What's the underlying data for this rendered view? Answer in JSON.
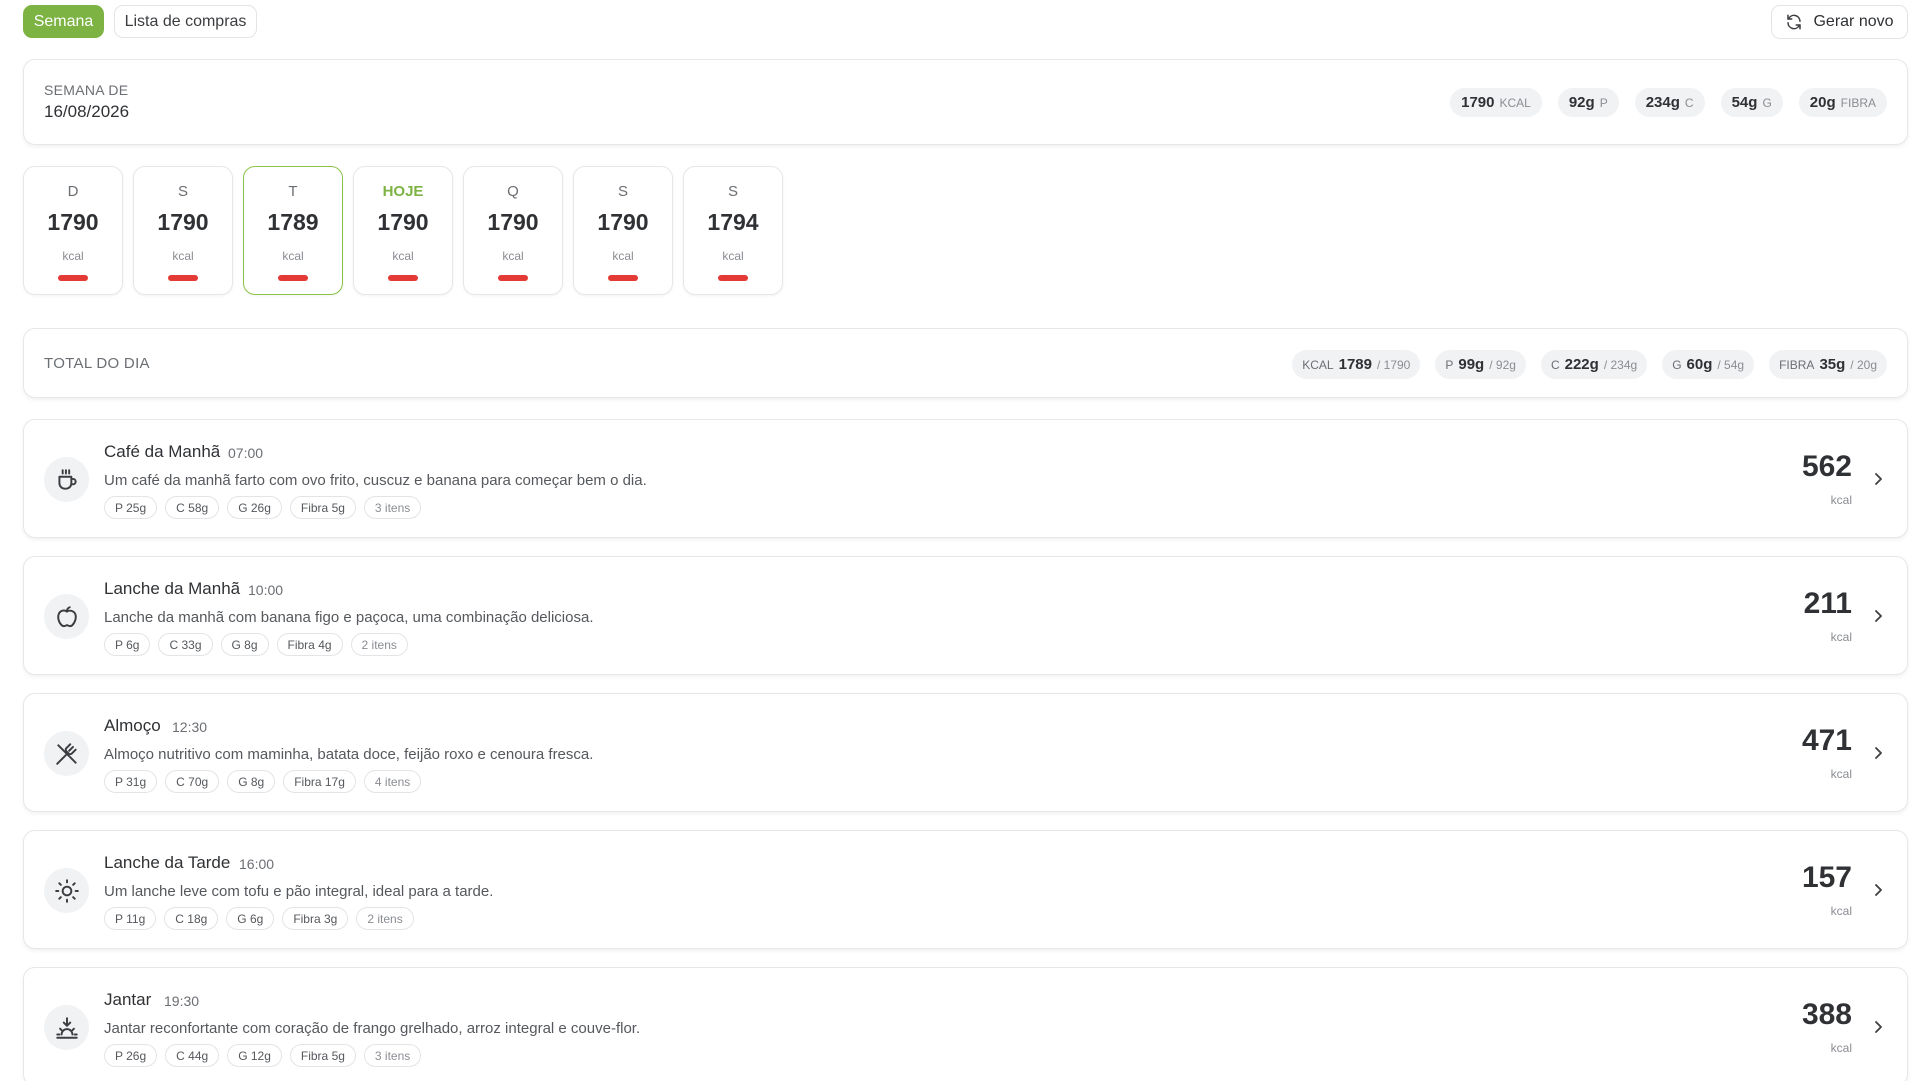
{
  "tabs": {
    "week": "Semana",
    "shopping": "Lista de compras",
    "generate": "Gerar novo"
  },
  "week": {
    "label": "SEMANA DE",
    "date": "16/08/2026",
    "macros": [
      {
        "value": "1790",
        "unit": "KCAL"
      },
      {
        "value": "92g",
        "unit": "P"
      },
      {
        "value": "234g",
        "unit": "C"
      },
      {
        "value": "54g",
        "unit": "G"
      },
      {
        "value": "20g",
        "unit": "FIBRA"
      }
    ]
  },
  "days": [
    {
      "label": "D",
      "kcal": "1790",
      "unit": "kcal"
    },
    {
      "label": "S",
      "kcal": "1790",
      "unit": "kcal"
    },
    {
      "label": "T",
      "kcal": "1789",
      "unit": "kcal",
      "selected": true
    },
    {
      "label": "HOJE",
      "kcal": "1790",
      "unit": "kcal",
      "today": true
    },
    {
      "label": "Q",
      "kcal": "1790",
      "unit": "kcal"
    },
    {
      "label": "S",
      "kcal": "1790",
      "unit": "kcal"
    },
    {
      "label": "S",
      "kcal": "1794",
      "unit": "kcal"
    }
  ],
  "total": {
    "label": "TOTAL DO DIA",
    "items": [
      {
        "key": "KCAL",
        "value": "1789",
        "target": "/ 1790"
      },
      {
        "key": "P",
        "value": "99g",
        "target": "/ 92g"
      },
      {
        "key": "C",
        "value": "222g",
        "target": "/ 234g"
      },
      {
        "key": "G",
        "value": "60g",
        "target": "/ 54g"
      },
      {
        "key": "FIBRA",
        "value": "35g",
        "target": "/ 20g"
      }
    ]
  },
  "meals": [
    {
      "name": "Café da Manhã",
      "time": "07:00",
      "desc": "Um café da manhã farto com ovo frito, cuscuz e banana para começar bem o dia.",
      "chips": [
        "P 25g",
        "C 58g",
        "G 26g",
        "Fibra 5g"
      ],
      "items": "3 itens",
      "kcal": "562",
      "unit": "kcal",
      "icon": "coffee-icon"
    },
    {
      "name": "Lanche da Manhã",
      "time": "10:00",
      "desc": "Lanche da manhã com banana figo e paçoca, uma combinação deliciosa.",
      "chips": [
        "P 6g",
        "C 33g",
        "G 8g",
        "Fibra 4g"
      ],
      "items": "2 itens",
      "kcal": "211",
      "unit": "kcal",
      "icon": "apple-icon"
    },
    {
      "name": "Almoço",
      "time": "12:30",
      "desc": "Almoço nutritivo com maminha, batata doce, feijão roxo e cenoura fresca.",
      "chips": [
        "P 31g",
        "C 70g",
        "G 8g",
        "Fibra 17g"
      ],
      "items": "4 itens",
      "kcal": "471",
      "unit": "kcal",
      "icon": "utensils-icon"
    },
    {
      "name": "Lanche da Tarde",
      "time": "16:00",
      "desc": "Um lanche leve com tofu e pão integral, ideal para a tarde.",
      "chips": [
        "P 11g",
        "C 18g",
        "G 6g",
        "Fibra 3g"
      ],
      "items": "2 itens",
      "kcal": "157",
      "unit": "kcal",
      "icon": "sun-icon"
    },
    {
      "name": "Jantar",
      "time": "19:30",
      "desc": "Jantar reconfortante com coração de frango grelhado, arroz integral e couve-flor.",
      "chips": [
        "P 26g",
        "C 44g",
        "G 12g",
        "Fibra 5g"
      ],
      "items": "3 itens",
      "kcal": "388",
      "unit": "kcal",
      "icon": "sunset-icon"
    }
  ],
  "colors": {
    "accent": "#7cb342",
    "bar": "#e53935",
    "pill": "#f1f2f4"
  }
}
